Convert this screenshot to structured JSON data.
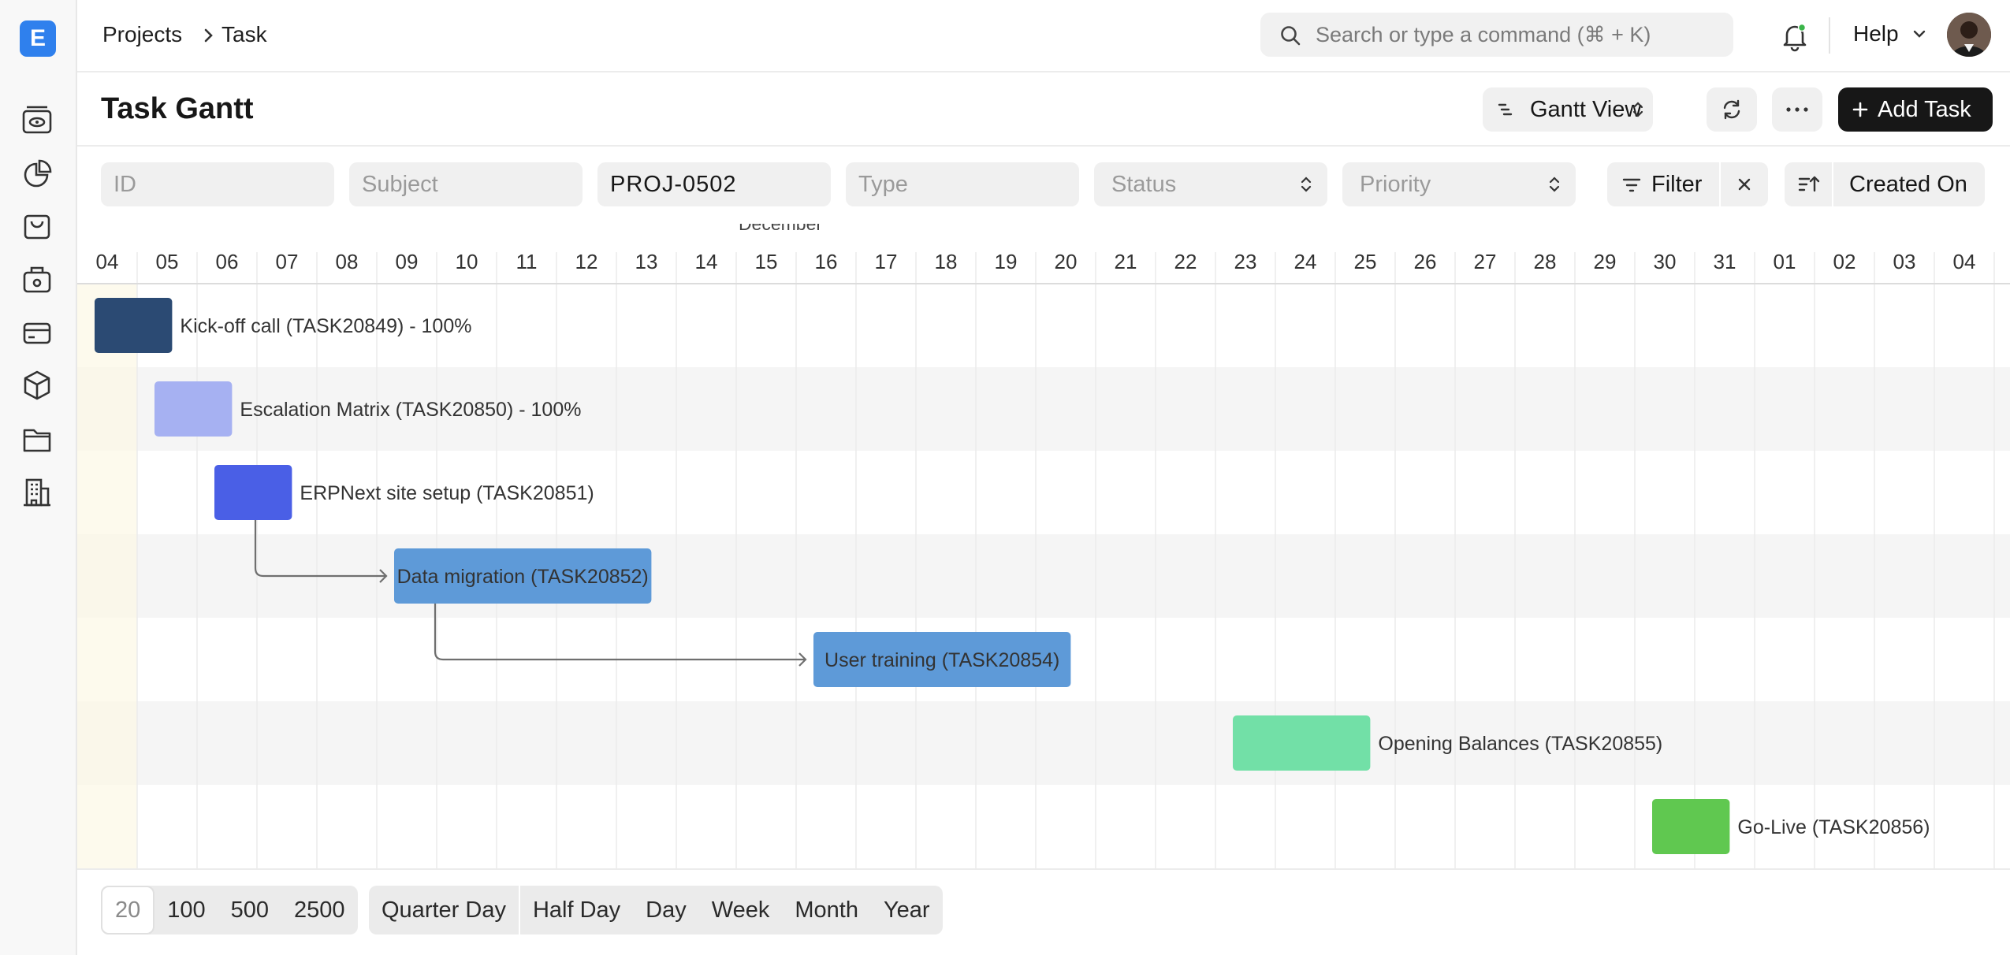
{
  "app": {
    "logo_letter": "E",
    "accent": "#2f80ed"
  },
  "sidebar": {
    "items": [
      {
        "icon": "view-icon"
      },
      {
        "icon": "pie-chart-icon"
      },
      {
        "icon": "shopping-bag-icon"
      },
      {
        "icon": "store-icon"
      },
      {
        "icon": "card-icon"
      },
      {
        "icon": "package-icon"
      },
      {
        "icon": "folder-icon"
      },
      {
        "icon": "building-icon"
      }
    ]
  },
  "breadcrumb": {
    "items": [
      "Projects",
      "Task"
    ]
  },
  "search": {
    "placeholder": "Search or type a command (⌘ + K)"
  },
  "topbar": {
    "help_label": "Help"
  },
  "page": {
    "title": "Task Gantt"
  },
  "toolbar": {
    "view_label": "Gantt View",
    "add_label": "Add Task"
  },
  "filters": {
    "id_placeholder": "ID",
    "subject_placeholder": "Subject",
    "project_value": "PROJ-0502",
    "type_placeholder": "Type",
    "status_placeholder": "Status",
    "priority_placeholder": "Priority",
    "filter_label": "Filter",
    "sort_label": "Created On"
  },
  "gantt": {
    "month_label": "December",
    "dates": [
      "04",
      "05",
      "06",
      "07",
      "08",
      "09",
      "10",
      "11",
      "12",
      "13",
      "14",
      "15",
      "16",
      "17",
      "18",
      "19",
      "20",
      "21",
      "22",
      "23",
      "24",
      "25",
      "26",
      "27",
      "28",
      "29",
      "30",
      "31",
      "01",
      "02",
      "03",
      "04"
    ],
    "tasks": [
      {
        "label": "Kick-off call (TASK20849) - 100%",
        "start": 0,
        "end": 1.4,
        "color": "#2b4a73",
        "label_inside": false
      },
      {
        "label": "Escalation Matrix (TASK20850) - 100%",
        "start": 1,
        "end": 2.4,
        "color": "#a6b1f2",
        "label_inside": false
      },
      {
        "label": "ERPNext site setup (TASK20851)",
        "start": 2,
        "end": 3.4,
        "color": "#4a5fe6",
        "label_inside": false
      },
      {
        "label": "Data migration (TASK20852)",
        "start": 5,
        "end": 9.4,
        "color": "#5e9ad8",
        "label_inside": true
      },
      {
        "label": "User training (TASK20854)",
        "start": 12,
        "end": 16.4,
        "color": "#5e9ad8",
        "label_inside": true
      },
      {
        "label": "Opening Balances (TASK20855)",
        "start": 19,
        "end": 21.4,
        "color": "#72e0a7",
        "label_inside": false
      },
      {
        "label": "Go-Live (TASK20856)",
        "start": 26,
        "end": 27.4,
        "color": "#60c850",
        "label_inside": false
      }
    ],
    "dependencies": [
      [
        2,
        3
      ],
      [
        3,
        4
      ]
    ]
  },
  "footer": {
    "page_sizes": [
      "20",
      "100",
      "500",
      "2500"
    ],
    "selected_page_size": "20",
    "view_modes": [
      "Quarter Day",
      "Half Day",
      "Day",
      "Week",
      "Month",
      "Year"
    ]
  }
}
